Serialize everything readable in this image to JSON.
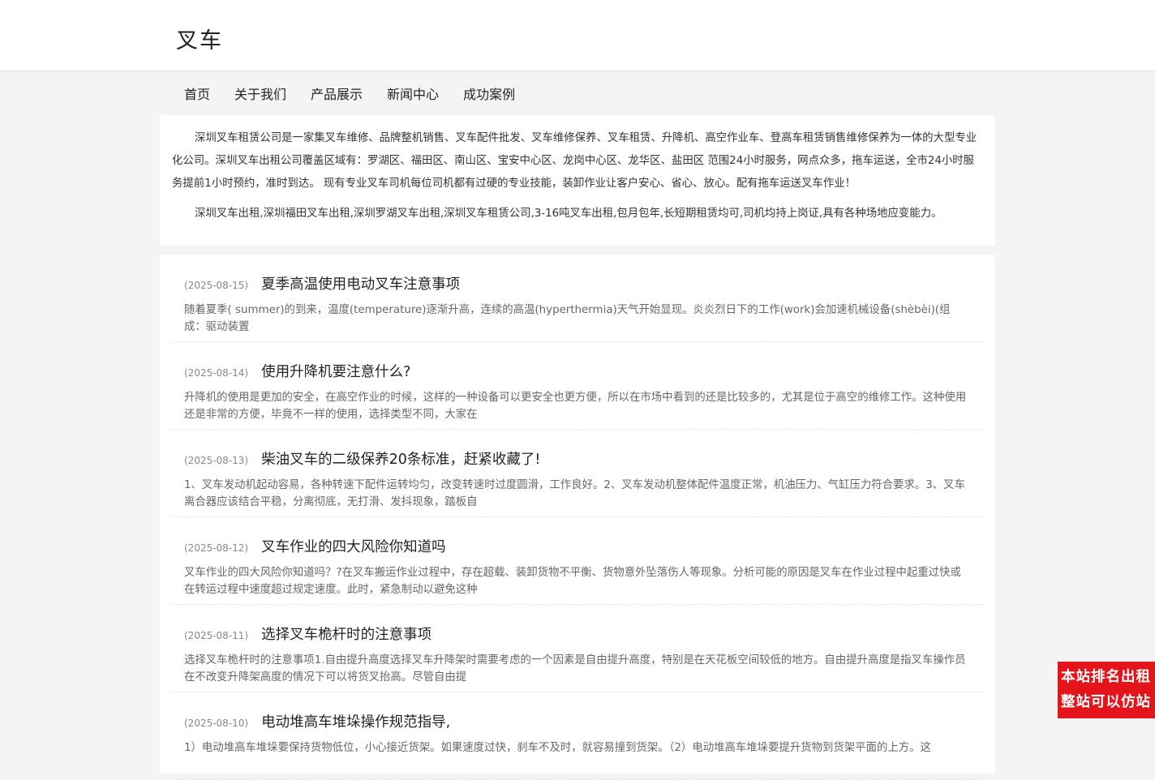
{
  "site": {
    "title": "叉车"
  },
  "nav": {
    "items": [
      {
        "label": "首页"
      },
      {
        "label": "关于我们"
      },
      {
        "label": "产品展示"
      },
      {
        "label": "新闻中心"
      },
      {
        "label": "成功案例"
      }
    ]
  },
  "intro": {
    "paragraphs": [
      "深圳叉车租赁公司是一家集叉车维修、品牌整机销售、叉车配件批发、叉车维修保养、叉车租赁、升降机、高空作业车、登高车租赁销售维修保养为一体的大型专业化公司。深圳叉车出租公司覆盖区域有：罗湖区、福田区、南山区、宝安中心区、龙岗中心区、龙华区、盐田区 范围24小时服务，网点众多，拖车运送，全市24小时服务提前1小时预约，准时到达。 现有专业叉车司机每位司机都有过硬的专业技能，装卸作业让客户安心、省心、放心。配有拖车运送叉车作业！",
      "深圳叉车出租,深圳福田叉车出租,深圳罗湖叉车出租,深圳叉车租赁公司,3-16吨叉车出租,包月包年,长短期租赁均可,司机均持上岗证,具有各种场地应变能力。"
    ]
  },
  "news": {
    "items": [
      {
        "date": "(2025-08-15)",
        "title": "夏季高温使用电动叉车注意事项",
        "summary": "随着夏季( summer)的到来，温度(temperature)逐渐升高，连续的高温(hyperthermia)天气开始显现。炎炎烈日下的工作(work)会加速机械设备(shèbèi)(组成：驱动装置"
      },
      {
        "date": "(2025-08-14)",
        "title": "使用升降机要注意什么?",
        "summary": "升降机的使用是更加的安全，在高空作业的时候，这样的一种设备可以更安全也更方便，所以在市场中看到的还是比较多的，尤其是位于高空的维修工作。这种使用还是非常的方便，毕竟不一样的使用，选择类型不同，大家在"
      },
      {
        "date": "(2025-08-13)",
        "title": "柴油叉车的二级保养20条标准，赶紧收藏了!",
        "summary": "1、叉车发动机起动容易，各种转速下配件运转均匀，改变转速时过度圆滑，工作良好。2、叉车发动机整体配件温度正常，机油压力、气缸压力符合要求。3、叉车离合器应该结合平稳，分离彻底，无打滑、发抖现象，踏板自"
      },
      {
        "date": "(2025-08-12)",
        "title": "叉车作业的四大风险你知道吗",
        "summary": "叉车作业的四大风险你知道吗？?在叉车搬运作业过程中，存在超载、装卸货物不平衡、货物意外坠落伤人等现象。分析可能的原因是叉车在作业过程中起重过快或在转运过程中速度超过规定速度。此时，紧急制动以避免这种"
      },
      {
        "date": "(2025-08-11)",
        "title": "选择叉车桅杆时的注意事项",
        "summary": "选择叉车桅杆时的注意事项1.自由提升高度选择叉车升降架时需要考虑的一个因素是自由提升高度，特别是在天花板空间较低的地方。自由提升高度是指叉车操作员在不改变升降架高度的情况下可以将货叉抬高。尽管自由提"
      },
      {
        "date": "(2025-08-10)",
        "title": "电动堆高车堆垛操作规范指导,",
        "summary": "1）电动堆高车堆垛要保持货物低位，小心接近货架。如果速度过快，刹车不及时，就容易撞到货架。（2）电动堆高车堆垛要提升货物到货架平面的上方。这"
      }
    ]
  },
  "badge": {
    "line1": "本站排名出租",
    "line2": "整站可以仿站"
  }
}
